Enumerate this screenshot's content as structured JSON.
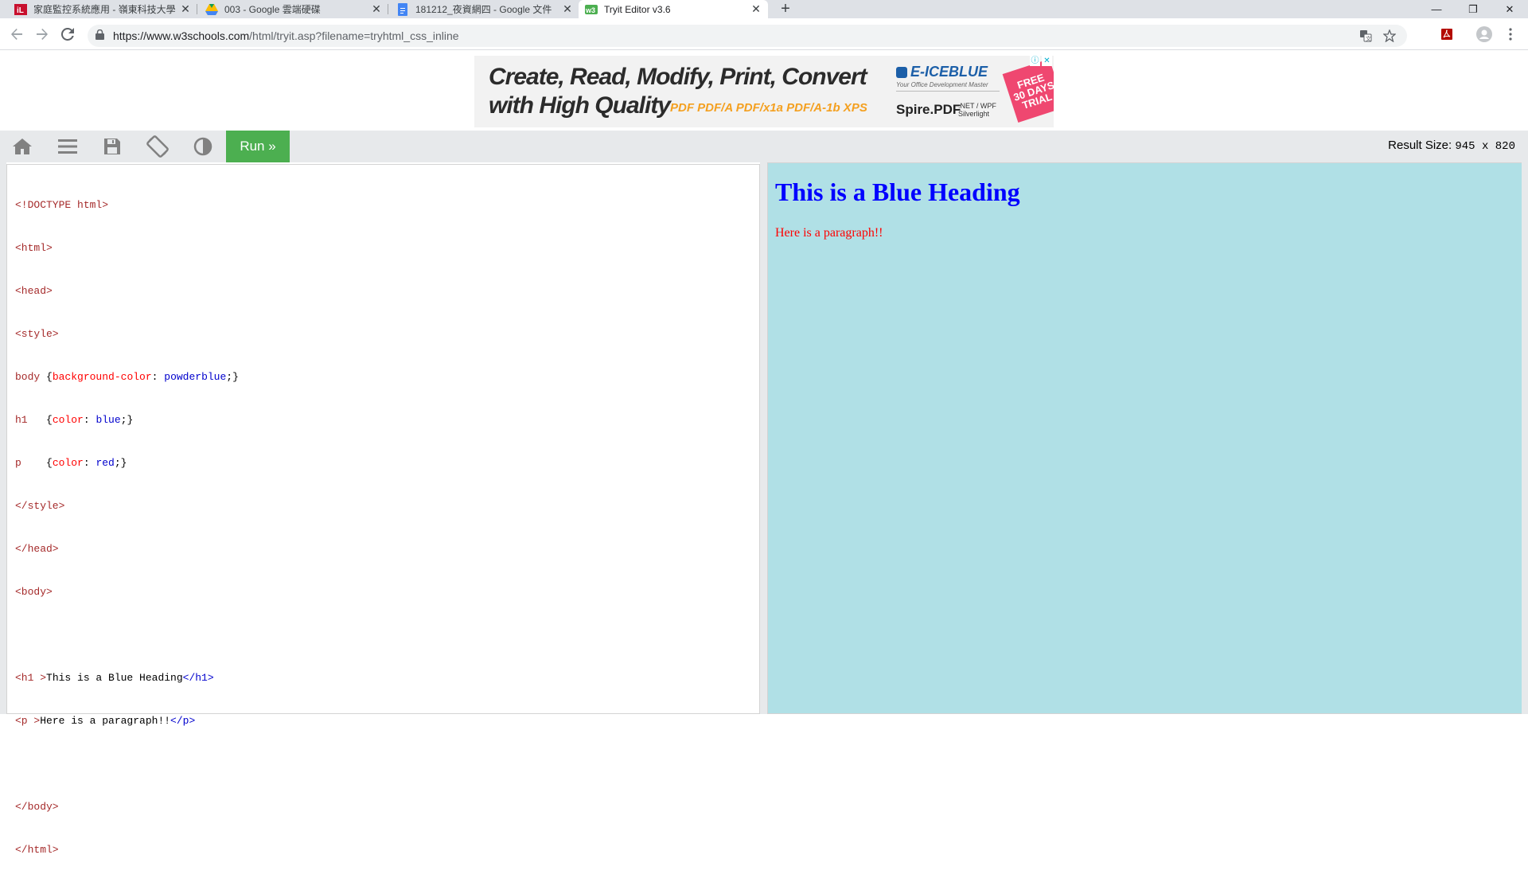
{
  "browser": {
    "tabs": [
      {
        "title": "家庭監控系統應用 - 嶺東科技大學",
        "active": false
      },
      {
        "title": "003 - Google 雲端硬碟",
        "active": false
      },
      {
        "title": "181212_夜資網四 - Google 文件",
        "active": false
      },
      {
        "title": "Tryit Editor v3.6",
        "active": true
      }
    ],
    "new_tab_symbol": "+",
    "window_controls": {
      "minimize": "—",
      "restore": "❐",
      "close": "✕"
    },
    "url_main": "https://www.w3schools.com",
    "url_rest": "/html/tryit.asp?filename=tryhtml_css_inline",
    "icons": [
      "back-icon",
      "forward-icon",
      "reload-icon",
      "lock-icon",
      "translate-icon",
      "bookmark-star-icon",
      "pdf-extension-icon",
      "profile-icon",
      "menu-kebab-icon"
    ]
  },
  "ad": {
    "line1": "Create, Read, Modify, Print, Convert",
    "line2": "with High Quality",
    "formats": "PDF PDF/A PDF/x1a PDF/A-1b XPS",
    "brand": "E-ICEBLUE",
    "brand_tag": "Your Office Development Master",
    "product": "Spire.PDF",
    "platforms_1": ".NET / WPF",
    "platforms_2": "Silverlight",
    "badge": "FREE\n30 DAYS\nTRIAL",
    "badge_color": "#ef4770"
  },
  "editor_toolbar": {
    "run_label": "Run »",
    "run_color": "#4caf50",
    "result_size_label": "Result Size:",
    "result_size_value": "945 x 820",
    "icons": [
      "home-icon",
      "menu-icon",
      "save-icon",
      "rotate-icon",
      "contrast-icon"
    ]
  },
  "code": {
    "l1": "<!DOCTYPE html>",
    "l2": "<html>",
    "l3": "<head>",
    "l4": "<style>",
    "l5_sel": "body ",
    "l5_open": "{",
    "l5_prop": "background-color",
    "l5_colon": ": ",
    "l5_val": "powderblue",
    "l5_end": ";}",
    "l6_sel": "h1   ",
    "l6_open": "{",
    "l6_prop": "color",
    "l6_colon": ": ",
    "l6_val": "blue",
    "l6_end": ";}",
    "l7_sel": "p    ",
    "l7_open": "{",
    "l7_prop": "color",
    "l7_colon": ": ",
    "l7_val": "red",
    "l7_end": ";}",
    "l8": "</style>",
    "l9": "</head>",
    "l10": "<body>",
    "l12_open": "<h1 >",
    "l12_text": "This is a Blue Heading",
    "l12_close": "</h1>",
    "l13_open": "<p >",
    "l13_text": "Here is a paragraph!!",
    "l13_close": "</p>",
    "l15": "</body>",
    "l16": "</html>"
  },
  "preview": {
    "heading": "This is a Blue Heading",
    "paragraph": "Here is a paragraph!!",
    "background": "#b0e0e6",
    "heading_color": "#0000ff",
    "paragraph_color": "#ff0000"
  }
}
